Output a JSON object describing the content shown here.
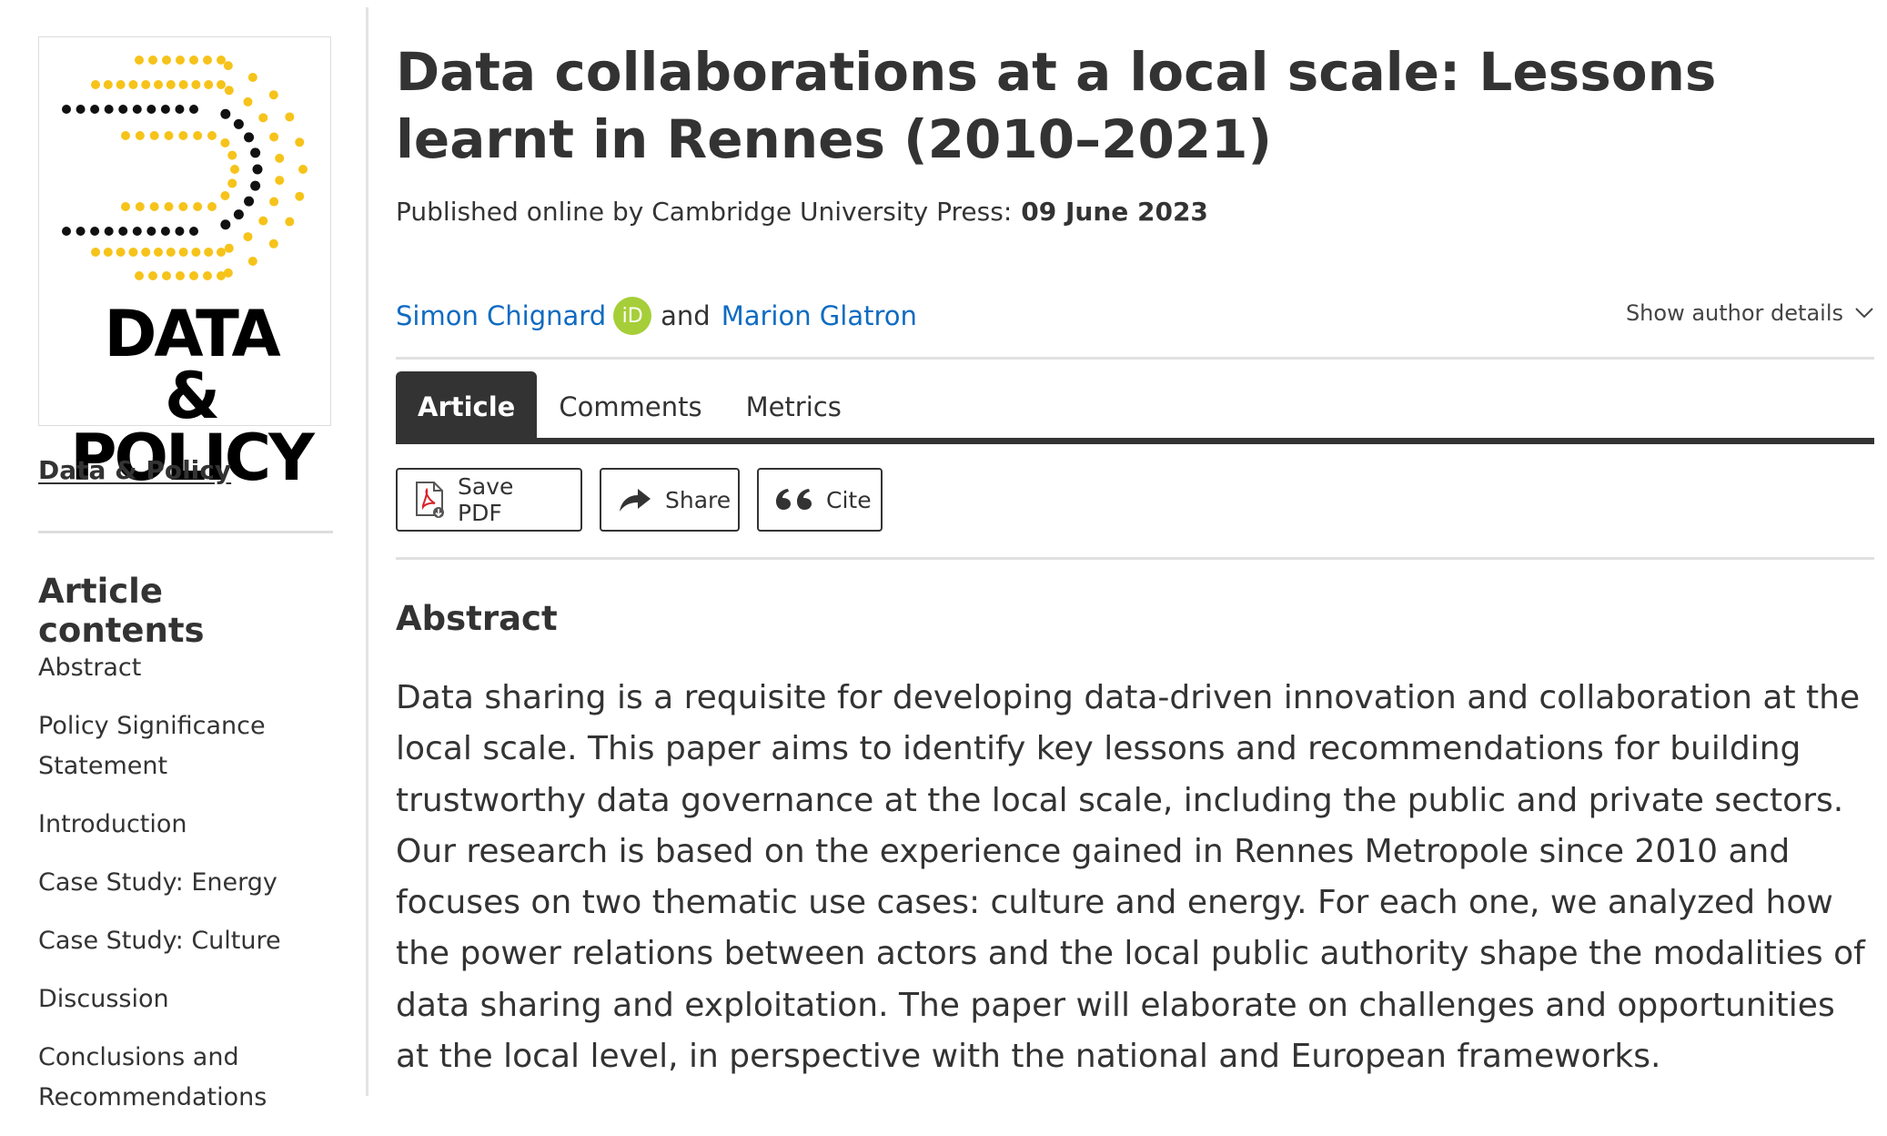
{
  "journal": {
    "logo_text": "DATA & POLICY",
    "name": "Data & Policy"
  },
  "sidebar": {
    "contents_title": "Article contents",
    "toc": [
      {
        "label": "Abstract"
      },
      {
        "label": "Policy Significance Statement"
      },
      {
        "label": "Introduction"
      },
      {
        "label": "Case Study: Energy"
      },
      {
        "label": "Case Study: Culture"
      },
      {
        "label": "Discussion"
      },
      {
        "label": "Conclusions and Recommendations"
      }
    ]
  },
  "article": {
    "title": "Data collaborations at a local scale: Lessons learnt in Rennes (2010–2021)",
    "published_label": "Published online by Cambridge University Press:",
    "published_date": "09 June 2023",
    "authors": [
      {
        "name": "Simon Chignard",
        "orcid": "iD"
      },
      {
        "name": "Marion Glatron"
      }
    ],
    "and_text": "and",
    "show_author_details": "Show author details"
  },
  "tabs": [
    {
      "label": "Article",
      "active": true
    },
    {
      "label": "Comments",
      "active": false
    },
    {
      "label": "Metrics",
      "active": false
    }
  ],
  "actions": {
    "save_pdf": "Save PDF",
    "share": "Share",
    "cite": "Cite"
  },
  "abstract": {
    "heading": "Abstract",
    "text": "Data sharing is a requisite for developing data-driven innovation and collaboration at the local scale. This paper aims to identify key lessons and recommendations for building trustworthy data governance at the local scale, including the public and private sectors. Our research is based on the experience gained in Rennes Metropole since 2010 and focuses on two thematic use cases: culture and energy. For each one, we analyzed how the power relations between actors and the local public authority shape the modalities of data sharing and exploitation. The paper will elaborate on challenges and opportunities at the local level, in perspective with the national and European frameworks."
  },
  "colors": {
    "link": "#0f6bc2",
    "orcid": "#a6ce39",
    "logo_yellow": "#f6c31a",
    "dark": "#333333"
  }
}
